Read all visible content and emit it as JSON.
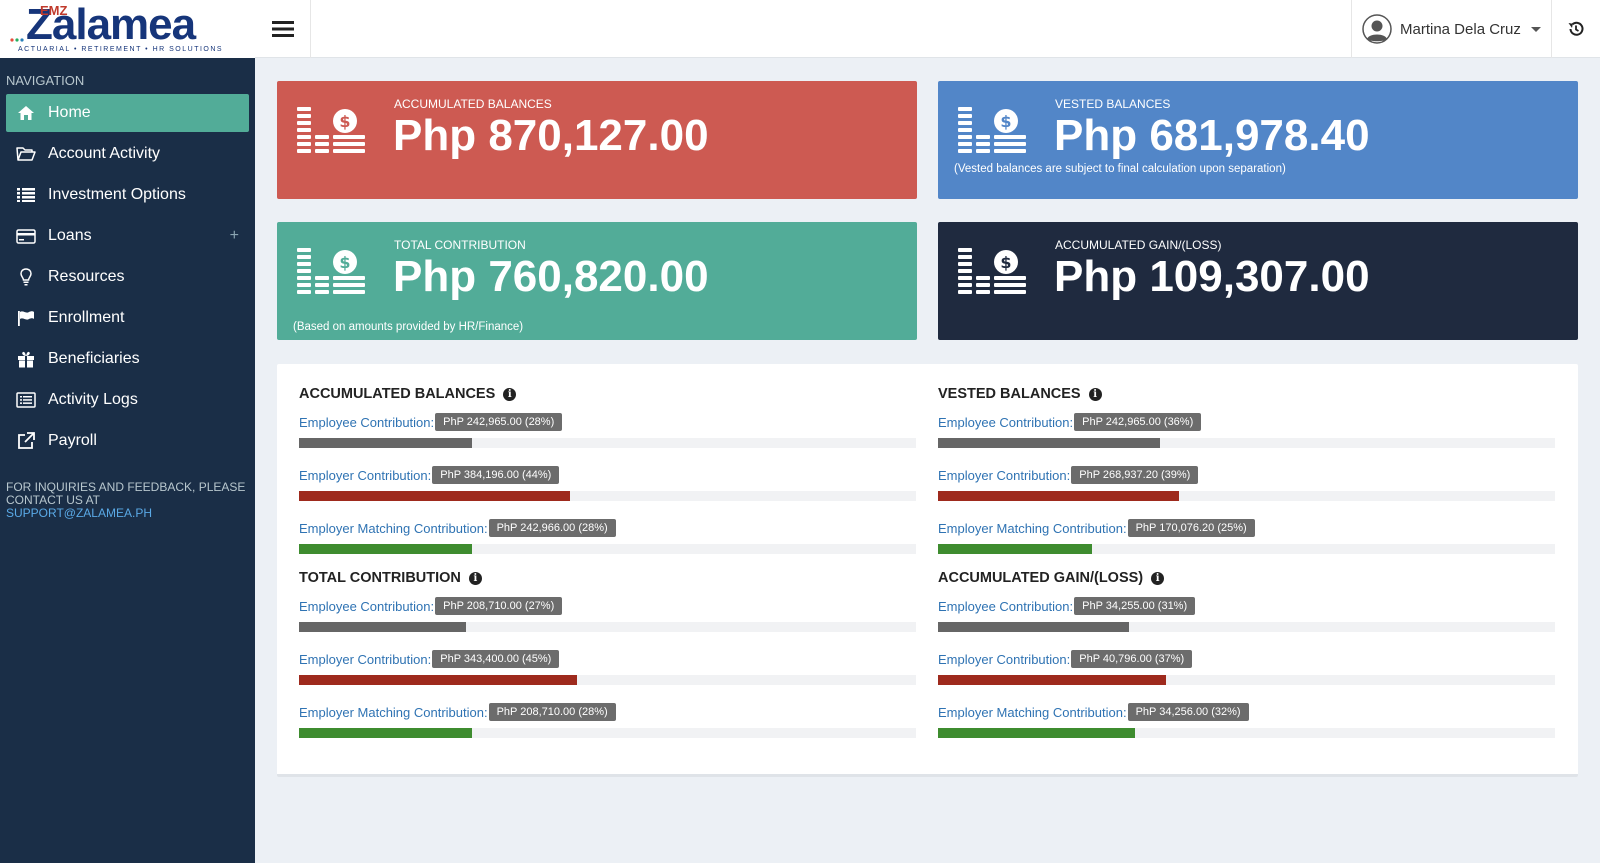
{
  "logo": {
    "brand": "Zalamea",
    "mark": "EMZ",
    "tagline": "ACTUARIAL  •  RETIREMENT  •  HR SOLUTIONS"
  },
  "sidebar": {
    "nav_title": "NAVIGATION",
    "items": [
      {
        "label": "Home",
        "icon": "home-icon",
        "active": true
      },
      {
        "label": "Account Activity",
        "icon": "folder-open-icon"
      },
      {
        "label": "Investment Options",
        "icon": "list-icon"
      },
      {
        "label": "Loans",
        "icon": "credit-card-icon",
        "expand": "+"
      },
      {
        "label": "Resources",
        "icon": "lightbulb-icon"
      },
      {
        "label": "Enrollment",
        "icon": "flag-icon"
      },
      {
        "label": "Beneficiaries",
        "icon": "gift-icon"
      },
      {
        "label": "Activity Logs",
        "icon": "list-alt-icon"
      },
      {
        "label": "Payroll",
        "icon": "external-link-icon"
      }
    ],
    "inquiry_text": "FOR INQUIRIES AND FEEDBACK, PLEASE CONTACT US AT",
    "inquiry_email": "SUPPORT@ZALAMEA.PH"
  },
  "header": {
    "user_name": "Martina Dela Cruz"
  },
  "stats": {
    "accumulated": {
      "label": "ACCUMULATED BALANCES",
      "value": "Php 870,127.00"
    },
    "vested": {
      "label": "VESTED BALANCES",
      "value": "Php 681,978.40",
      "note": "(Vested balances are subject to final calculation upon separation)"
    },
    "total": {
      "label": "TOTAL CONTRIBUTION",
      "value": "Php 760,820.00",
      "note": "(Based on amounts provided by HR/Finance)"
    },
    "gain": {
      "label": "ACCUMULATED GAIN/(LOSS)",
      "value": "Php 109,307.00"
    }
  },
  "colors": {
    "red": "#cd5a52",
    "blue": "#5286c8",
    "green": "#52ac98",
    "dark": "#1f2a3f",
    "sidebar": "#1a2e47"
  },
  "breakdown": {
    "accumulated": {
      "title": "ACCUMULATED BALANCES",
      "rows": [
        {
          "label": "Employee Contribution:",
          "amount": "PhP 242,965.00 (28%)",
          "percent": 28
        },
        {
          "label": "Employer Contribution:",
          "amount": "PhP 384,196.00 (44%)",
          "percent": 44
        },
        {
          "label": "Employer Matching Contribution:",
          "amount": "PhP 242,966.00 (28%)",
          "percent": 28
        }
      ]
    },
    "vested": {
      "title": "VESTED BALANCES",
      "rows": [
        {
          "label": "Employee Contribution:",
          "amount": "PhP 242,965.00 (36%)",
          "percent": 36
        },
        {
          "label": "Employer Contribution:",
          "amount": "PhP 268,937.20 (39%)",
          "percent": 39
        },
        {
          "label": "Employer Matching Contribution:",
          "amount": "PhP 170,076.20 (25%)",
          "percent": 25
        }
      ]
    },
    "total": {
      "title": "TOTAL CONTRIBUTION",
      "rows": [
        {
          "label": "Employee Contribution:",
          "amount": "PhP 208,710.00 (27%)",
          "percent": 27
        },
        {
          "label": "Employer Contribution:",
          "amount": "PhP 343,400.00 (45%)",
          "percent": 45
        },
        {
          "label": "Employer Matching Contribution:",
          "amount": "PhP 208,710.00 (28%)",
          "percent": 28
        }
      ]
    },
    "gain": {
      "title": "ACCUMULATED GAIN/(LOSS)",
      "rows": [
        {
          "label": "Employee Contribution:",
          "amount": "PhP 34,255.00 (31%)",
          "percent": 31
        },
        {
          "label": "Employer Contribution:",
          "amount": "PhP 40,796.00 (37%)",
          "percent": 37
        },
        {
          "label": "Employer Matching Contribution:",
          "amount": "PhP 34,256.00 (32%)",
          "percent": 32
        }
      ]
    }
  }
}
